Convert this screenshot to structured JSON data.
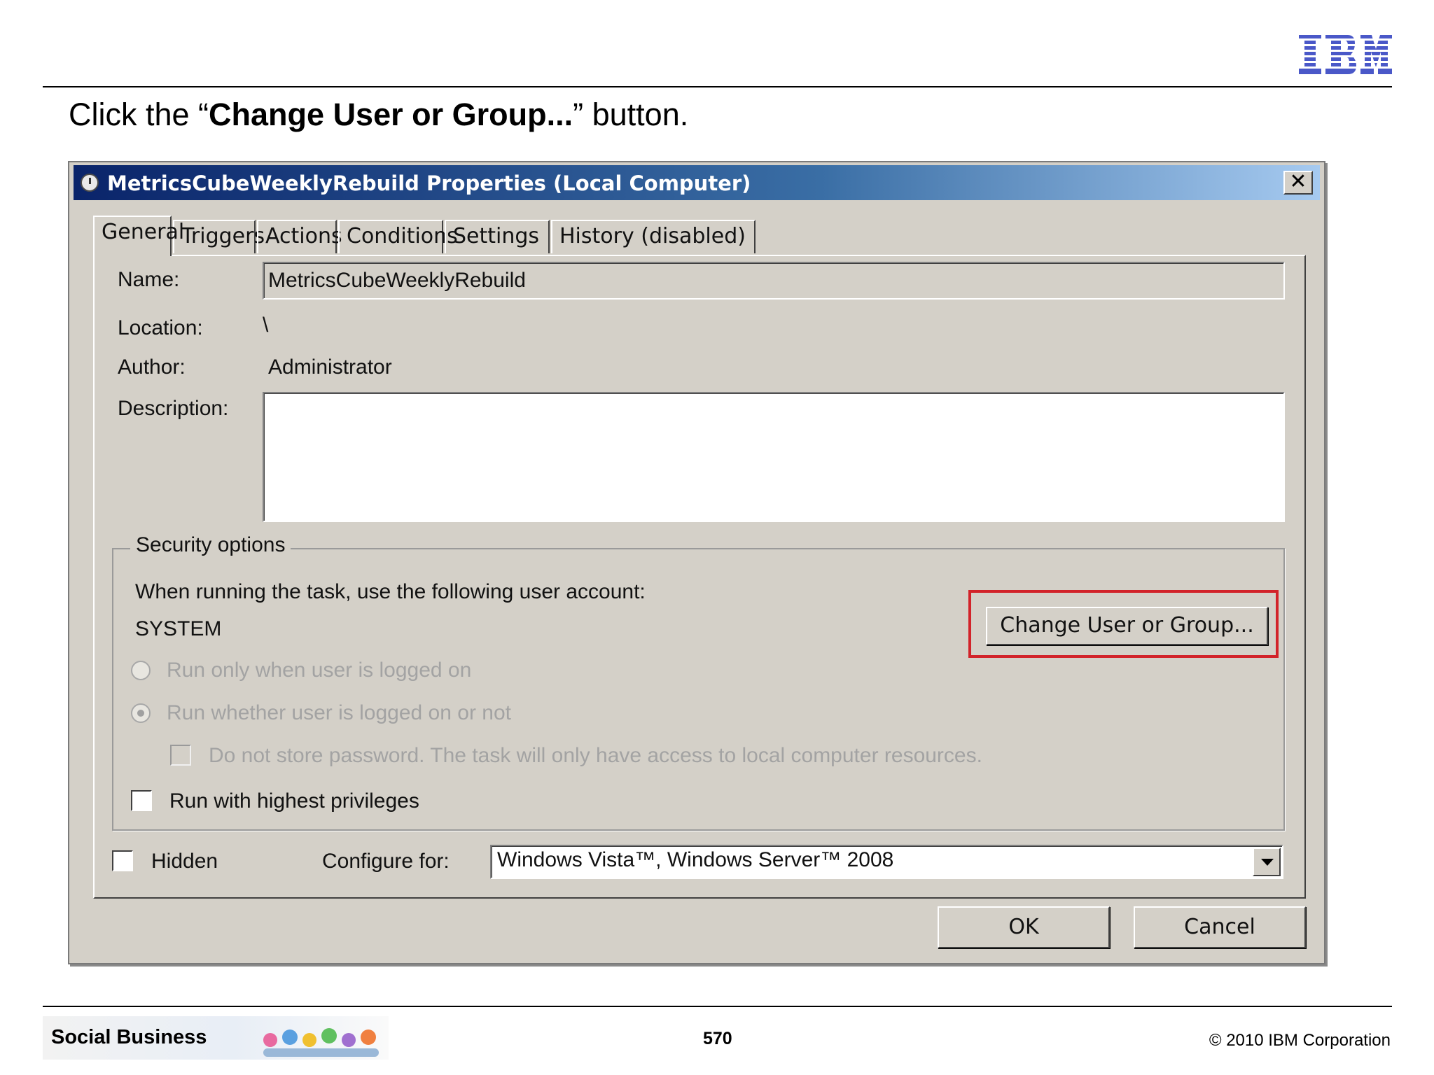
{
  "slide": {
    "brand": "IBM",
    "instruction_before": "Click the “",
    "instruction_bold": "Change User or Group...",
    "instruction_after": "” button."
  },
  "dialog": {
    "title": "MetricsCubeWeeklyRebuild Properties (Local Computer)",
    "close_label": "✕",
    "tabs": [
      {
        "label": "General",
        "active": true
      },
      {
        "label": "Triggers"
      },
      {
        "label": "Actions"
      },
      {
        "label": "Conditions"
      },
      {
        "label": "Settings"
      },
      {
        "label": "History (disabled)"
      }
    ],
    "general": {
      "name_label": "Name:",
      "name_value": "MetricsCubeWeeklyRebuild",
      "location_label": "Location:",
      "location_value": "\\",
      "author_label": "Author:",
      "author_value": "Administrator",
      "description_label": "Description:",
      "description_value": ""
    },
    "security": {
      "group_title": "Security options",
      "account_prompt": "When running the task, use the following user account:",
      "account_value": "SYSTEM",
      "change_button": "Change User or Group...",
      "radio_logged_on": "Run only when user is logged on",
      "radio_whether": "Run whether user is logged on or not",
      "no_store_password": "Do not store password.  The task will only have access to local computer resources.",
      "highest_privileges": "Run with highest privileges"
    },
    "hidden_label": "Hidden",
    "configure_label": "Configure for:",
    "configure_value": "Windows Vista™, Windows Server™ 2008",
    "ok_button": "OK",
    "cancel_button": "Cancel"
  },
  "footer": {
    "brand": "Social Business",
    "page_number": "570",
    "copyright": "© 2010 IBM Corporation"
  },
  "colors": {
    "highlight": "#d2232a",
    "ibm_blue": "#4a58c8",
    "dialog_face": "#d4d0c8",
    "title_bar": "#0a246a"
  }
}
